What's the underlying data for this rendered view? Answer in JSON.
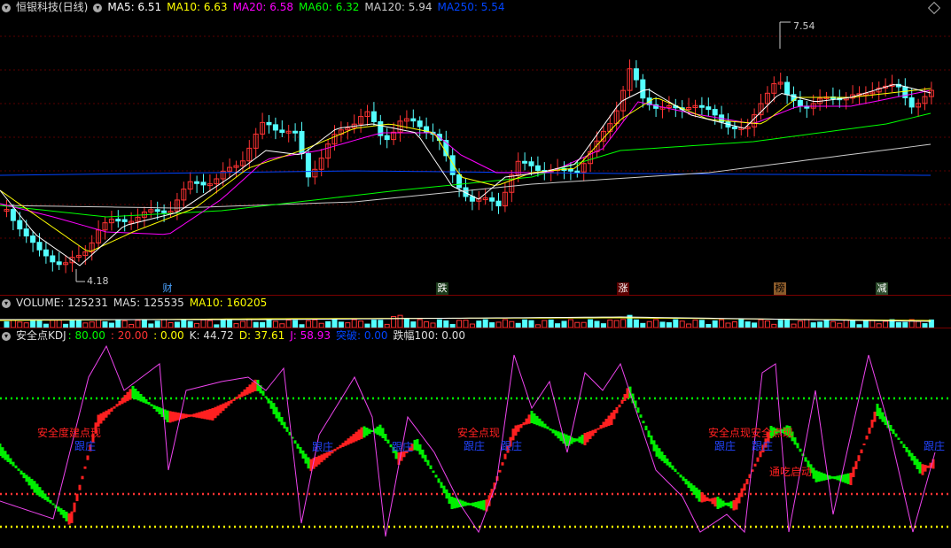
{
  "main": {
    "title": "恒银科技(日线)",
    "ma5": "MA5: 6.51",
    "ma10": "MA10: 6.63",
    "ma20": "MA20: 6.58",
    "ma60": "MA60: 6.32",
    "ma120": "MA120: 5.94",
    "ma250": "MA250: 5.54",
    "high_label": "7.54",
    "low_label": "4.18",
    "events": [
      "财",
      "跌",
      "涨",
      "榜",
      "减"
    ],
    "colors": {
      "ma5": "#ffffff",
      "ma10": "#ffff00",
      "ma20": "#ff00ff",
      "ma60": "#00ff00",
      "ma120": "#cccccc",
      "ma250": "#0044ff",
      "up": "#ff3333",
      "down": "#54ffff"
    }
  },
  "volume": {
    "title": "VOLUME: 125231",
    "ma5": "MA5: 125535",
    "ma10": "MA10: 160205"
  },
  "kdj": {
    "title": "安全点KDJ",
    "v1": ": 80.00",
    "v2": ": 20.00",
    "v3": ": 0.00",
    "k": "K: 44.72",
    "d": "D: 37.61",
    "j": "J: 58.93",
    "tuopo": "突破: 0.00",
    "diefu": "跌幅100: 0.00",
    "annotations": {
      "a1": "安全度建点现",
      "a2": "跟庄",
      "a3": "跟庄",
      "a4": "跟庄",
      "a5": "安全点现",
      "a6": "跟庄",
      "a7": "跟庄",
      "a8": "安全点现安全点现",
      "a9": "跟庄",
      "a10": "跟庄",
      "a11": "通吃启动",
      "a12": "跟庄"
    }
  }
}
